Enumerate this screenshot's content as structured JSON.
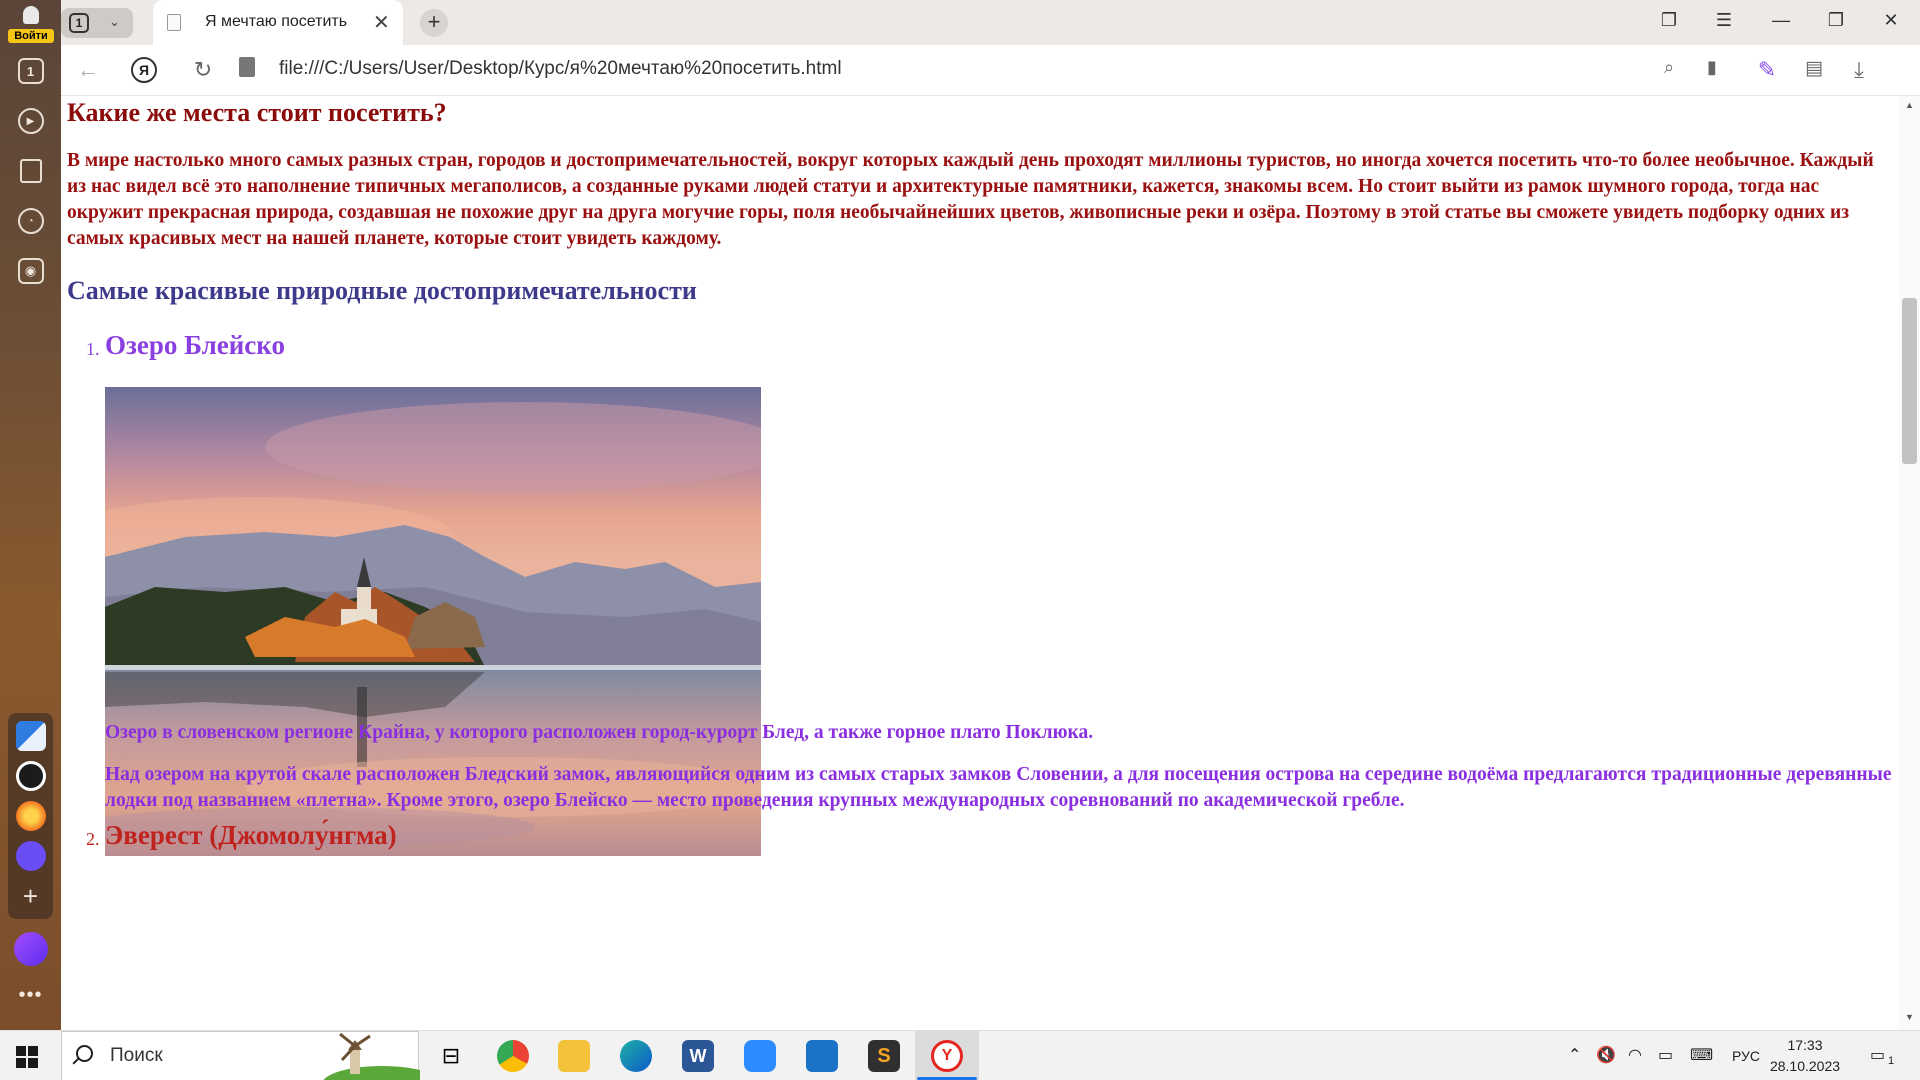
{
  "browser": {
    "login_label": "Войти",
    "tab_count": "1",
    "tab_title": "Я мечтаю посетить",
    "address": "file:///C:/Users/User/Desktop/Курс/я%20мечтаю%20посетить.html",
    "sidebar_counter": "1"
  },
  "page": {
    "heading_places": "Какие же места стоит посетить?",
    "intro": "В мире настолько много самых разных стран, городов и достопримечательностей, вокруг которых каждый день проходят миллионы туристов, но иногда хочется посетить что-то более необычное. Каждый из нас видел всё это наполнение типичных мегаполисов, а созданные руками людей статуи и архитектурные памятники, кажется, знакомы всем. Но стоит выйти из рамок шумного города, тогда нас окружит прекрасная природа, создавшая не похожие друг на друга могучие горы, поля необычайнейших цветов, живописные реки и озёра. Поэтому в этой статье вы сможете увидеть подборку одних из самых красивых мест на нашей планете, которые стоит увидеть каждому.",
    "heading_nature": "Самые красивые природные достопримечательности",
    "items": [
      {
        "number": "1.",
        "title": "Озеро Блейско",
        "desc1": "Озеро в словенском регионе Крайна, у которого расположен город-курорт Блед, а также горное плато Поклюка.",
        "desc2": "Над озером на крутой скале расположен Бледский замок, являющийся одним из самых старых замков Словении, а для посещения острова на середине водоёма предлагаются традиционные деревянные лодки под названием «плетна». Кроме этого, озеро Блейско — место проведения крупных международных соревнований по академической гребле."
      },
      {
        "number": "2.",
        "title": "Эверест (Джомолу́нгма)"
      }
    ]
  },
  "taskbar": {
    "search_placeholder": "Поиск",
    "language": "РУС",
    "time": "17:33",
    "date": "28.10.2023",
    "notifications": "1"
  },
  "colors": {
    "heading_places": "#8b0a0a",
    "intro": "#9a0f0f",
    "heading_nature": "#3d3a8c",
    "list_accent": "#8a3fe0"
  }
}
